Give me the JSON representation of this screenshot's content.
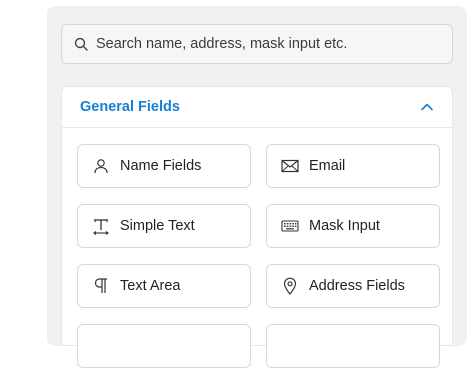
{
  "search": {
    "placeholder": "Search name, address, mask input etc."
  },
  "section": {
    "title": "General Fields",
    "accent": "#1a7fd4",
    "fields": [
      {
        "label": "Name Fields",
        "icon": "user-icon"
      },
      {
        "label": "Email",
        "icon": "envelope-icon"
      },
      {
        "label": "Simple Text",
        "icon": "text-cursor-icon"
      },
      {
        "label": "Mask Input",
        "icon": "keyboard-icon"
      },
      {
        "label": "Text Area",
        "icon": "paragraph-icon"
      },
      {
        "label": "Address Fields",
        "icon": "map-pin-icon"
      }
    ]
  }
}
